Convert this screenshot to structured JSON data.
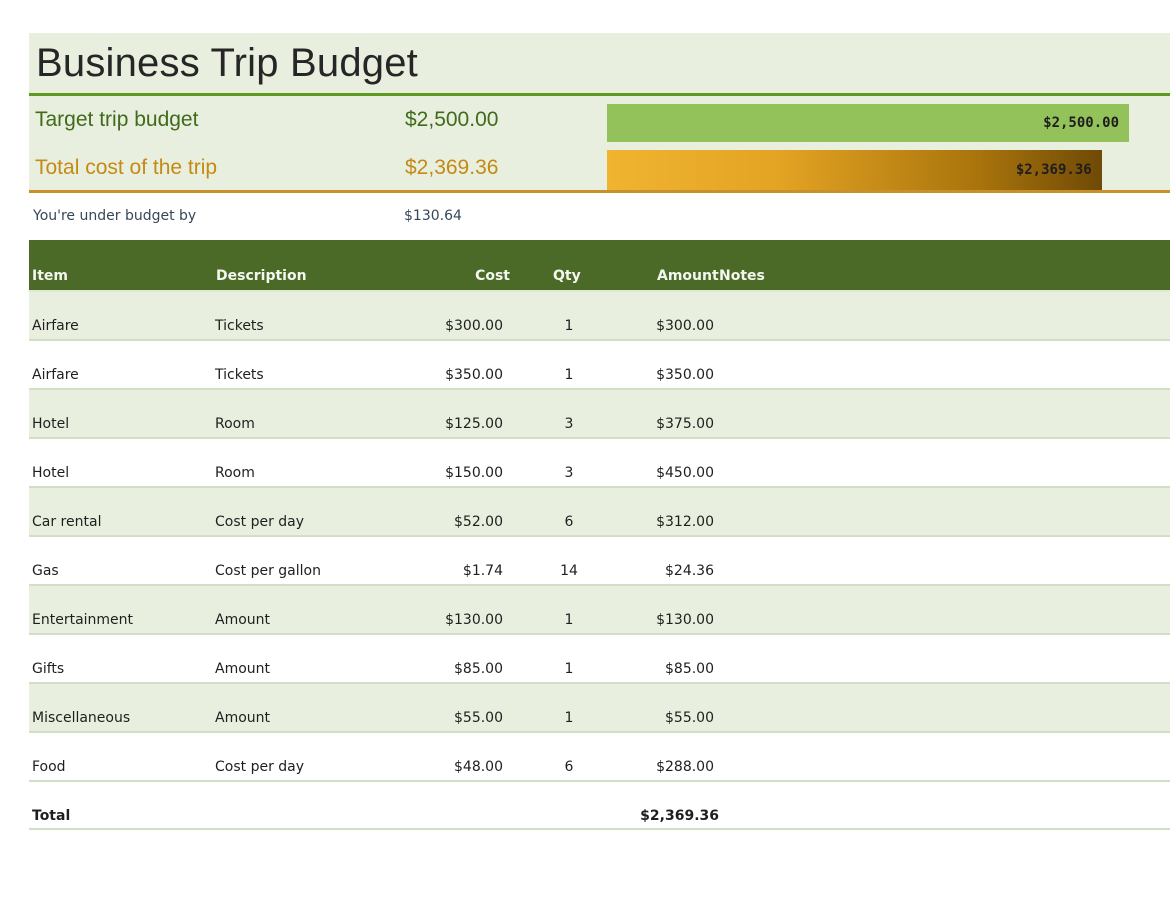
{
  "title": "Business Trip Budget",
  "summary": {
    "target": {
      "label": "Target trip budget",
      "value": "$2,500.00",
      "bar_label": "$2,500.00",
      "bar_fraction": 1.0
    },
    "total": {
      "label": "Total cost of the trip",
      "value": "$2,369.36",
      "bar_label": "$2,369.36",
      "bar_fraction": 0.9477
    },
    "under": {
      "label": "You're under budget by",
      "value": "$130.64"
    }
  },
  "colors": {
    "header_green": "#4b6a27",
    "band": "#e9efdf",
    "bar_green": "#93c25a",
    "bar_gold": "#e3a323",
    "accent_line": "#5e9a1e"
  },
  "table": {
    "headers": {
      "item": "Item",
      "description": "Description",
      "cost": "Cost",
      "qty": "Qty",
      "amount": "Amount",
      "notes": "Notes"
    },
    "rows": [
      {
        "item": "Airfare",
        "description": "Tickets",
        "cost": "$300.00",
        "qty": "1",
        "amount": "$300.00"
      },
      {
        "item": "Airfare",
        "description": "Tickets",
        "cost": "$350.00",
        "qty": "1",
        "amount": "$350.00"
      },
      {
        "item": "Hotel",
        "description": "Room",
        "cost": "$125.00",
        "qty": "3",
        "amount": "$375.00"
      },
      {
        "item": "Hotel",
        "description": "Room",
        "cost": "$150.00",
        "qty": "3",
        "amount": "$450.00"
      },
      {
        "item": "Car rental",
        "description": "Cost per day",
        "cost": "$52.00",
        "qty": "6",
        "amount": "$312.00"
      },
      {
        "item": "Gas",
        "description": "Cost per gallon",
        "cost": "$1.74",
        "qty": "14",
        "amount": "$24.36"
      },
      {
        "item": "Entertainment",
        "description": "Amount",
        "cost": "$130.00",
        "qty": "1",
        "amount": "$130.00"
      },
      {
        "item": "Gifts",
        "description": "Amount",
        "cost": "$85.00",
        "qty": "1",
        "amount": "$85.00"
      },
      {
        "item": "Miscellaneous",
        "description": "Amount",
        "cost": "$55.00",
        "qty": "1",
        "amount": "$55.00"
      },
      {
        "item": "Food",
        "description": "Cost per day",
        "cost": "$48.00",
        "qty": "6",
        "amount": "$288.00"
      }
    ],
    "total": {
      "label": "Total",
      "amount": "$2,369.36"
    }
  }
}
